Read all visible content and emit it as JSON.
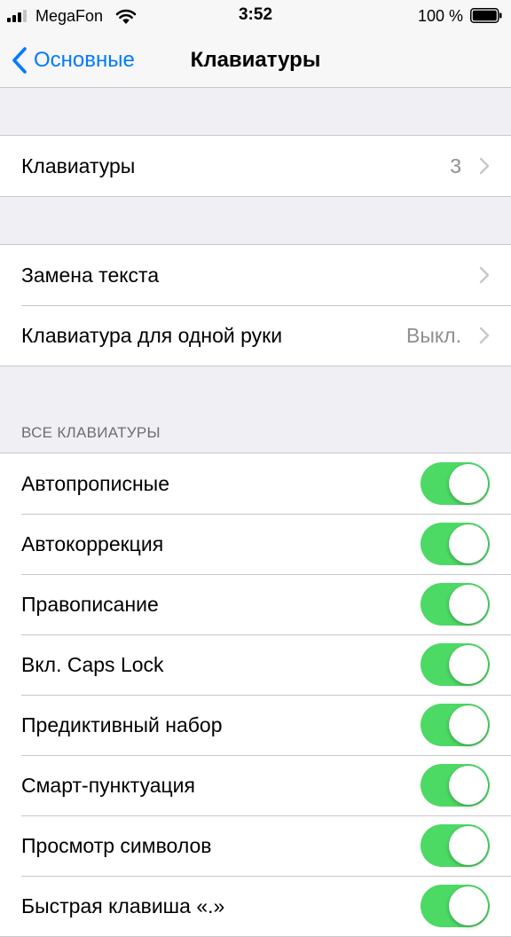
{
  "status_bar": {
    "carrier": "MegaFon",
    "time": "3:52",
    "battery_percent": "100 %",
    "signal_icon": "signal-icon",
    "wifi_icon": "wifi-icon",
    "battery_icon": "battery-icon"
  },
  "nav": {
    "back_label": "Основные",
    "title": "Клавиатуры",
    "back_icon": "chevron-left-icon"
  },
  "group1": {
    "keyboards_label": "Клавиатуры",
    "keyboards_count": "3"
  },
  "group2": {
    "text_replacement_label": "Замена текста",
    "one_handed_label": "Клавиатура для одной руки",
    "one_handed_value": "Выкл."
  },
  "all_keyboards": {
    "header": "ВСЕ КЛАВИАТУРЫ",
    "toggles": [
      {
        "label": "Автопрописные",
        "on": true
      },
      {
        "label": "Автокоррекция",
        "on": true
      },
      {
        "label": "Правописание",
        "on": true
      },
      {
        "label": "Вкл. Caps Lock",
        "on": true
      },
      {
        "label": "Предиктивный набор",
        "on": true
      },
      {
        "label": "Смарт-пунктуация",
        "on": true
      },
      {
        "label": "Просмотр символов",
        "on": true
      },
      {
        "label": "Быстрая клавиша «.»",
        "on": true
      }
    ]
  },
  "colors": {
    "accent": "#007aff",
    "toggle_on": "#4cd964",
    "background": "#efeff4",
    "secondary_text": "#8e8e93"
  }
}
